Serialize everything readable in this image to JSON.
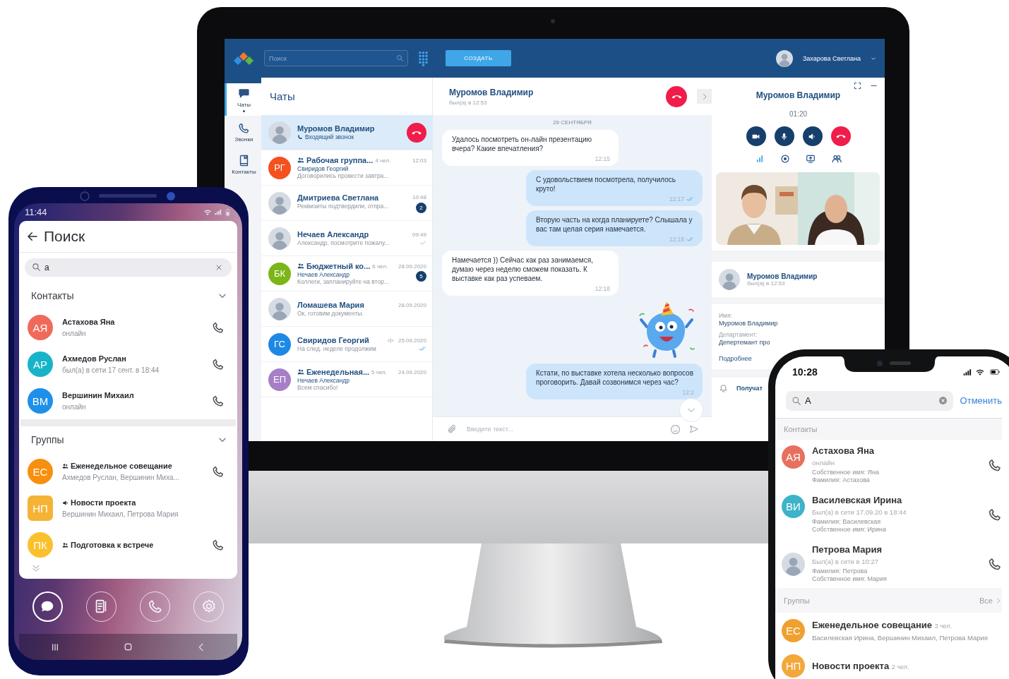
{
  "desktop": {
    "top_bar": {
      "search_placeholder": "Поиск",
      "create_button": "СОЗДАТЬ",
      "user_name": "Захарова Светлана"
    },
    "nav": [
      {
        "label": "Чаты",
        "selected": true
      },
      {
        "label": "Звонки",
        "selected": false
      },
      {
        "label": "Контакты",
        "selected": false
      }
    ],
    "chat_list": {
      "title": "Чаты",
      "items": [
        {
          "kind": "call",
          "name": "Муромов Владимир",
          "subtitle": "Входящий звонок",
          "selected": true
        },
        {
          "kind": "group",
          "initials": "РГ",
          "color": "#f4511e",
          "name": "Рабочая группа...",
          "members": "4 чел.",
          "time": "12:03",
          "sender": "Свиридов Георгий",
          "preview": "Договорились провести завтра...",
          "selected": false
        },
        {
          "kind": "chat",
          "name": "Дмитриева Светлана",
          "time": "10:48",
          "preview": "Реквизиты подтвердили, отпра...",
          "unread": "2",
          "selected": false
        },
        {
          "kind": "chat",
          "name": "Нечаев Александр",
          "time": "09:49",
          "preview": "Александр, посмотрите пожалу...",
          "delivered": true,
          "read": false,
          "selected": false
        },
        {
          "kind": "group",
          "initials": "БК",
          "color": "#7cb518",
          "name": "Бюджетный ко...",
          "members": "6 чел.",
          "time": "28.09.2020",
          "sender": "Нечаев Александр",
          "preview": "Коллеги, запланируйте на втор...",
          "unread": "5",
          "selected": false
        },
        {
          "kind": "chat",
          "name": "Ломашева Мария",
          "time": "28.09.2020",
          "preview": "Ок, готовим документы.",
          "selected": false
        },
        {
          "kind": "chat",
          "initials": "ГС",
          "color": "#1e88e5",
          "name": "Свиридов Георгий",
          "muted": true,
          "time": "25.09.2020",
          "preview": "На след. неделе продолжим",
          "delivered": true,
          "read": true,
          "selected": false
        },
        {
          "kind": "group",
          "initials": "ЕП",
          "color": "#a77fc7",
          "name": "Еженедельная...",
          "members": "5 чел.",
          "time": "24.09.2020",
          "sender": "Нечаев Александр",
          "preview": "Всем спасибо!",
          "selected": false
        }
      ]
    },
    "chat": {
      "name": "Муромов Владимир",
      "status": "был(а) в 12:53",
      "date": "29 СЕНТЯБРЯ",
      "input_placeholder": "Введите текст...",
      "messages": [
        {
          "kind": "text",
          "outgoing": false,
          "read": false,
          "text": "Удалось посмотреть он-лайн презентацию вчера? Какие впечатления?",
          "time": "12:15"
        },
        {
          "kind": "text",
          "outgoing": true,
          "read": true,
          "text": "С удовольствием посмотрела, получилось круто!",
          "time": "12:17"
        },
        {
          "kind": "text",
          "outgoing": true,
          "read": true,
          "text": "Вторую часть на когда планируете? Слышала у вас там целая серия намечается.",
          "time": "12:18"
        },
        {
          "kind": "text",
          "outgoing": false,
          "read": false,
          "text": "Намечается )) Сейчас как раз занимаемся, думаю через неделю сможем показать. К выставке как раз успеваем.",
          "time": "12:18"
        },
        {
          "kind": "sticker"
        },
        {
          "kind": "text",
          "outgoing": true,
          "read": false,
          "text": "Кстати, по выставке хотела несколько вопросов проговорить. Давай созвонимся через час?",
          "time": "12:2"
        }
      ]
    },
    "call": {
      "name": "Муромов Владимир",
      "timer": "01:20",
      "contact": {
        "name": "Муромов Владимир",
        "status": "был(а) в 12:53"
      },
      "fields": [
        {
          "label": "Имя:",
          "value": "Муромов Владимир"
        },
        {
          "label": "Департамент:",
          "value": "Депертемант про"
        }
      ],
      "more_link": "Подробнее",
      "notifications": "Получат"
    }
  },
  "android": {
    "time": "11:44",
    "title": "Поиск",
    "search_value": "а",
    "contacts_section": {
      "title": "Контакты",
      "expanded": true,
      "items": [
        {
          "initials": "АЯ",
          "color": "#ef6a5a",
          "name": "Астахова Яна",
          "status": "онлайн"
        },
        {
          "initials": "АР",
          "color": "#17b3c9",
          "name": "Ахмедов Руслан",
          "status": "был(а) в сети 17 сент. в 18:44"
        },
        {
          "initials": "ВМ",
          "color": "#1e90e8",
          "name": "Вершинин Михаил",
          "status": "онлайн"
        }
      ]
    },
    "groups_section": {
      "title": "Группы",
      "expanded": true,
      "items": [
        {
          "kind": "group",
          "initials": "ЕС",
          "color": "#f7900f",
          "name": "Еженедельное совещание",
          "members": "Ахмедов Руслан, Вершинин Миха...",
          "call": true
        },
        {
          "kind": "channel",
          "initials": "НП",
          "color": "#f5b335",
          "name": "Новости проекта",
          "members": "Вершинин Михаил, Петрова Мария",
          "call": false
        },
        {
          "kind": "group",
          "initials": "ПК",
          "color": "#fbc02d",
          "name": "Подготовка к встрече",
          "call": true
        }
      ]
    },
    "bottom_nav": [
      {
        "kind": "chats",
        "selected": true
      },
      {
        "kind": "contacts",
        "selected": false
      },
      {
        "kind": "calls",
        "selected": false
      },
      {
        "kind": "settings",
        "selected": false
      }
    ]
  },
  "iphone": {
    "time": "10:28",
    "search_value": "А",
    "cancel": "Отменить",
    "contacts_title": "Контакты",
    "contacts": [
      {
        "initials": "АЯ",
        "color": "#e8705f",
        "name": "Астахова Яна",
        "status": "онлайн",
        "details": [
          "Собственное имя: Яна",
          "Фамилия: Астахова"
        ]
      },
      {
        "initials": "ВИ",
        "color": "#3db3c9",
        "name": "Василевская Ирина",
        "status": "Был(а) в сети 17.09.20 в 18:44",
        "details": [
          "Фамилия: Василевская",
          "Собственное имя: Ирина"
        ]
      },
      {
        "name": "Петрова Мария",
        "status": "Был(а) в сети в 10:27",
        "details": [
          "Фамилия: Петрова",
          "Собственное имя: Мария"
        ]
      }
    ],
    "groups_title": "Группы",
    "all_link": "Все",
    "groups": [
      {
        "initials": "ЕС",
        "color": "#f0a030",
        "name": "Еженедельное совещание",
        "members_count": "3 чел.",
        "members": "Василевская Ирина, Вершинин Михаил, Петрова Мария"
      },
      {
        "initials": "НП",
        "color": "#f2a83a",
        "name": "Новости проекта",
        "members_count": "2 чел."
      }
    ]
  }
}
